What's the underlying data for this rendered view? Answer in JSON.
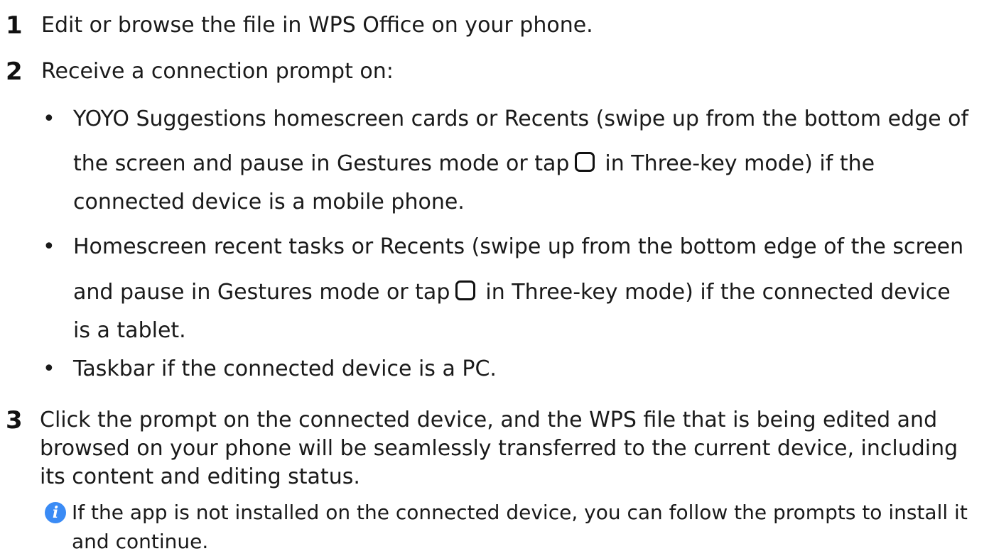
{
  "steps": [
    {
      "number": "1",
      "text": "Edit or browse the file in WPS Office on your phone."
    },
    {
      "number": "2",
      "text": "Receive a connection prompt on:"
    },
    {
      "number": "3",
      "lines": [
        "Click the prompt on the connected device, and the WPS file that is being edited and",
        "browsed on your phone will be seamlessly transferred to the current device, including",
        "its content and editing status."
      ]
    }
  ],
  "bullets": [
    {
      "line1": "YOYO Suggestions homescreen cards or Recents (swipe up from the bottom edge of",
      "line2_before": "the screen and pause in Gestures mode or tap",
      "line2_after": "in Three-key mode) if the",
      "line3": "connected device is a mobile phone."
    },
    {
      "line1": "Homescreen recent tasks or Recents (swipe up from the bottom edge of the screen",
      "line2_before": "and pause in Gestures mode or tap",
      "line2_after": "in Three-key mode) if the connected device",
      "line3": "is a tablet."
    },
    {
      "line1": "Taskbar if the connected device is a PC."
    }
  ],
  "bullet_char": "•",
  "note": {
    "icon": "info-icon",
    "icon_glyph": "i",
    "line1": "If the app is not installed on the connected device, you can follow the prompts to install it",
    "line2": "and continue."
  }
}
